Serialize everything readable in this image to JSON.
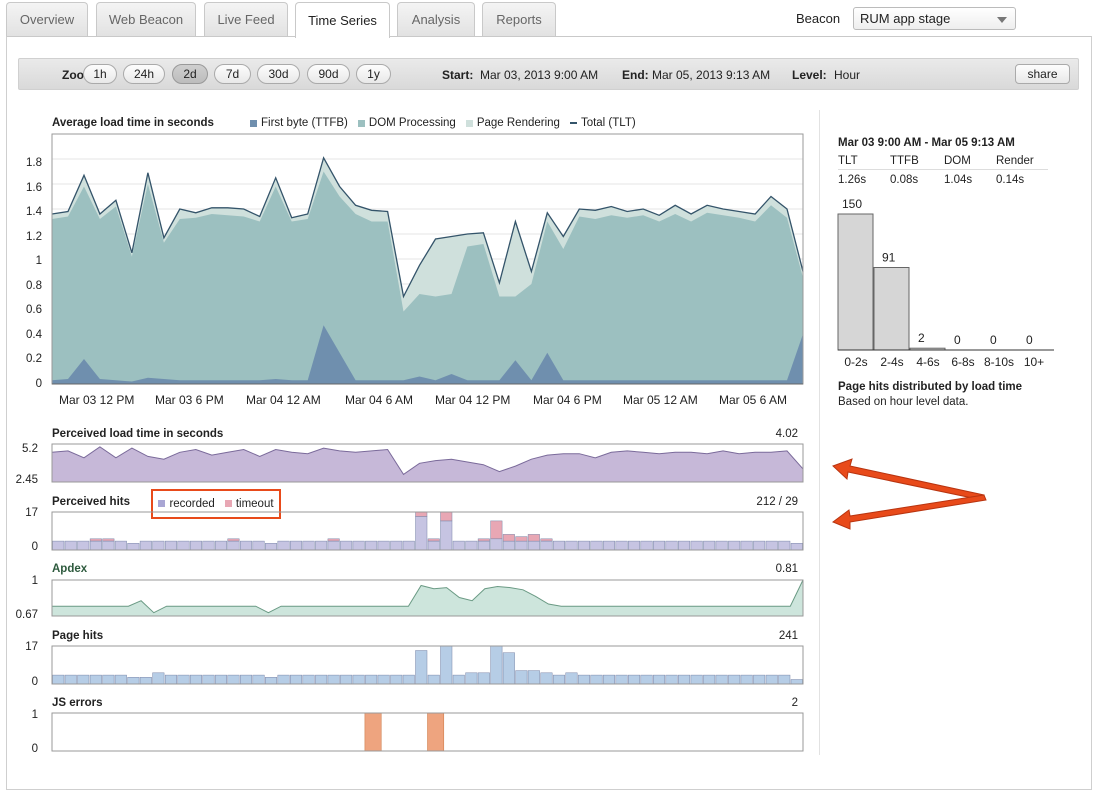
{
  "tabs": [
    {
      "label": "Overview",
      "active": false
    },
    {
      "label": "Web Beacon",
      "active": false
    },
    {
      "label": "Live Feed",
      "active": false
    },
    {
      "label": "Time Series",
      "active": true
    },
    {
      "label": "Analysis",
      "active": false
    },
    {
      "label": "Reports",
      "active": false
    }
  ],
  "beacon": {
    "label": "Beacon",
    "selected": "RUM app stage"
  },
  "toolbar": {
    "zoom_label": "Zoom:",
    "zoom_options": [
      "1h",
      "24h",
      "2d",
      "7d",
      "30d",
      "90d",
      "1y"
    ],
    "zoom_active": "2d",
    "start_label": "Start:",
    "start_value": "Mar 03, 2013 9:00 AM",
    "end_label": "End:",
    "end_value": "Mar 05, 2013 9:13 AM",
    "level_label": "Level:",
    "level_value": "Hour",
    "share_label": "share"
  },
  "colors": {
    "ttfb": "#6f8fae",
    "dom": "#9cc0c0",
    "render": "#cfe0dc",
    "total": "#34546a",
    "perceived": "#c6b8d8",
    "recorded": "#c6c4e2",
    "timeout": "#e8a7b4",
    "apdex": "#cde5dc",
    "pagehits": "#b6cde6",
    "jserrors": "#eea47f",
    "annotation": "#e84a1a"
  },
  "chart_data": [
    {
      "type": "area",
      "title": "Average load time in seconds",
      "legend": [
        "First byte (TTFB)",
        "DOM Processing",
        "Page Rendering",
        "Total (TLT)"
      ],
      "yticks": [
        "1.8",
        "1.6",
        "1.4",
        "1.2",
        "1",
        "0.8",
        "0.6",
        "0.4",
        "0.2",
        "0"
      ],
      "ylim": [
        0,
        2.0
      ],
      "xticks": [
        "Mar 03 12 PM",
        "Mar 03 6 PM",
        "Mar 04 12 AM",
        "Mar 04 6 AM",
        "Mar 04 12 PM",
        "Mar 04 6 PM",
        "Mar 05 12 AM",
        "Mar 05 6 AM"
      ],
      "series": [
        {
          "name": "Total (TLT)",
          "values": [
            1.36,
            1.38,
            1.67,
            1.36,
            1.47,
            1.05,
            1.69,
            1.17,
            1.4,
            1.37,
            1.41,
            1.41,
            1.4,
            1.34,
            1.65,
            1.33,
            1.36,
            1.81,
            1.58,
            1.43,
            1.39,
            1.38,
            0.7,
            0.95,
            1.16,
            1.18,
            1.2,
            1.21,
            0.81,
            1.3,
            0.9,
            1.37,
            1.18,
            1.4,
            1.39,
            1.42,
            1.38,
            1.4,
            1.35,
            1.43,
            1.36,
            1.43,
            1.4,
            1.38,
            1.36,
            1.5,
            1.4,
            0.9
          ]
        },
        {
          "name": "DOM+TTFB",
          "values": [
            1.32,
            1.34,
            1.58,
            1.32,
            1.42,
            1.02,
            1.6,
            1.13,
            1.32,
            1.33,
            1.36,
            1.35,
            1.34,
            1.3,
            1.58,
            1.3,
            1.32,
            1.7,
            1.5,
            1.36,
            1.3,
            1.3,
            0.58,
            0.72,
            0.7,
            0.72,
            1.1,
            1.12,
            0.7,
            0.7,
            0.8,
            1.3,
            1.08,
            1.34,
            1.32,
            1.35,
            1.33,
            1.35,
            1.3,
            1.36,
            1.3,
            1.37,
            1.35,
            1.33,
            1.3,
            1.43,
            1.33,
            0.85
          ]
        },
        {
          "name": "First byte (TTFB)",
          "values": [
            0.03,
            0.04,
            0.2,
            0.04,
            0.03,
            0.02,
            0.05,
            0.04,
            0.03,
            0.03,
            0.03,
            0.03,
            0.03,
            0.03,
            0.04,
            0.03,
            0.03,
            0.47,
            0.25,
            0.03,
            0.03,
            0.03,
            0.03,
            0.06,
            0.03,
            0.08,
            0.03,
            0.03,
            0.03,
            0.19,
            0.03,
            0.25,
            0.03,
            0.03,
            0.03,
            0.03,
            0.03,
            0.03,
            0.03,
            0.03,
            0.03,
            0.03,
            0.03,
            0.03,
            0.03,
            0.03,
            0.03,
            0.4
          ]
        }
      ]
    },
    {
      "type": "area",
      "title": "Perceived load time in seconds",
      "summary": "4.02",
      "yticks": [
        "5.2",
        "2.45"
      ],
      "ylim": [
        2.45,
        5.2
      ],
      "values": [
        4.6,
        4.7,
        4.2,
        5.0,
        4.2,
        4.9,
        4.3,
        4.1,
        4.6,
        4.8,
        4.4,
        4.6,
        4.8,
        4.3,
        4.8,
        4.6,
        4.5,
        4.9,
        4.7,
        4.6,
        4.7,
        4.8,
        3.0,
        3.8,
        4.0,
        4.1,
        3.9,
        3.7,
        3.2,
        3.6,
        4.1,
        4.4,
        4.5,
        4.5,
        4.2,
        4.6,
        4.7,
        4.6,
        4.5,
        4.6,
        4.6,
        4.5,
        4.7,
        4.5,
        4.6,
        4.6,
        4.7,
        3.4
      ]
    },
    {
      "type": "bar",
      "title": "Perceived hits",
      "summary": "212 / 29",
      "yticks": [
        "17",
        "0"
      ],
      "ylim": [
        0,
        17
      ],
      "legend": [
        "recorded",
        "timeout"
      ],
      "series": [
        {
          "name": "recorded",
          "values": [
            4,
            4,
            4,
            4,
            4,
            4,
            3,
            4,
            4,
            4,
            4,
            4,
            4,
            4,
            4,
            4,
            4,
            3,
            4,
            4,
            4,
            4,
            4,
            4,
            4,
            4,
            4,
            4,
            4,
            15,
            4,
            13,
            4,
            4,
            4,
            5,
            4,
            4,
            4,
            4,
            4,
            4,
            4,
            4,
            4,
            4,
            4,
            4,
            4,
            4,
            4,
            4,
            4,
            4,
            4,
            4,
            4,
            4,
            4,
            3
          ]
        },
        {
          "name": "timeout",
          "values": [
            0,
            0,
            0,
            1,
            1,
            0,
            0,
            0,
            0,
            0,
            0,
            0,
            0,
            0,
            1,
            0,
            0,
            0,
            0,
            0,
            0,
            0,
            1,
            0,
            0,
            0,
            0,
            0,
            0,
            2,
            1,
            4,
            0,
            0,
            1,
            8,
            3,
            2,
            3,
            1,
            0,
            0,
            0,
            0,
            0,
            0,
            0,
            0,
            0,
            0,
            0,
            0,
            0,
            0,
            0,
            0,
            0,
            0,
            0,
            0
          ]
        }
      ]
    },
    {
      "type": "area",
      "title": "Apdex",
      "summary": "0.81",
      "yticks": [
        "1",
        "0.67"
      ],
      "ylim": [
        0.67,
        1
      ],
      "values": [
        0.76,
        0.76,
        0.76,
        0.76,
        0.76,
        0.76,
        0.76,
        0.81,
        0.7,
        0.76,
        0.76,
        0.76,
        0.76,
        0.76,
        0.76,
        0.76,
        0.76,
        0.7,
        0.76,
        0.76,
        0.76,
        0.76,
        0.76,
        0.76,
        0.76,
        0.76,
        0.76,
        0.76,
        0.76,
        0.95,
        0.92,
        0.93,
        0.84,
        0.81,
        0.92,
        0.94,
        0.93,
        0.91,
        0.85,
        0.78,
        0.76,
        0.76,
        0.76,
        0.76,
        0.76,
        0.76,
        0.76,
        0.76,
        0.76,
        0.76,
        0.76,
        0.76,
        0.76,
        0.76,
        0.76,
        0.76,
        0.76,
        0.76,
        0.76,
        1.0
      ]
    },
    {
      "type": "bar",
      "title": "Page hits",
      "summary": "241",
      "yticks": [
        "17",
        "0"
      ],
      "ylim": [
        0,
        17
      ],
      "values": [
        4,
        4,
        4,
        4,
        4,
        4,
        3,
        3,
        5,
        4,
        4,
        4,
        4,
        4,
        4,
        4,
        4,
        3,
        4,
        4,
        4,
        4,
        4,
        4,
        4,
        4,
        4,
        4,
        4,
        15,
        4,
        17,
        4,
        5,
        5,
        17,
        14,
        6,
        6,
        5,
        4,
        5,
        4,
        4,
        4,
        4,
        4,
        4,
        4,
        4,
        4,
        4,
        4,
        4,
        4,
        4,
        4,
        4,
        4,
        2
      ]
    },
    {
      "type": "bar",
      "title": "JS errors",
      "summary": "2",
      "yticks": [
        "1",
        "0"
      ],
      "ylim": [
        0,
        1
      ],
      "values": [
        0,
        0,
        0,
        0,
        0,
        0,
        0,
        0,
        0,
        0,
        0,
        0,
        0,
        0,
        0,
        0,
        0,
        0,
        0,
        0,
        0,
        0,
        0,
        0,
        0,
        0,
        0,
        0,
        0,
        0,
        0,
        0,
        0,
        0,
        0,
        0,
        0,
        0,
        0,
        0,
        0,
        0,
        0,
        0,
        0,
        0,
        0,
        0,
        0,
        0,
        0,
        0,
        0,
        0,
        0,
        0,
        0,
        0,
        0,
        0
      ],
      "error_indices": [
        25,
        30
      ]
    },
    {
      "type": "bar",
      "title": "Page hits distributed by load time",
      "subtitle": "Based on hour level data.",
      "range_title": "Mar 03 9:00 AM - Mar 05 9:13 AM",
      "stats_headers": [
        "TLT",
        "TTFB",
        "DOM",
        "Render"
      ],
      "stats_values": [
        "1.26s",
        "0.08s",
        "1.04s",
        "0.14s"
      ],
      "categories": [
        "0-2s",
        "2-4s",
        "4-6s",
        "6-8s",
        "8-10s",
        "10+"
      ],
      "values": [
        150,
        91,
        2,
        0,
        0,
        0
      ],
      "ylim": [
        0,
        150
      ]
    }
  ]
}
